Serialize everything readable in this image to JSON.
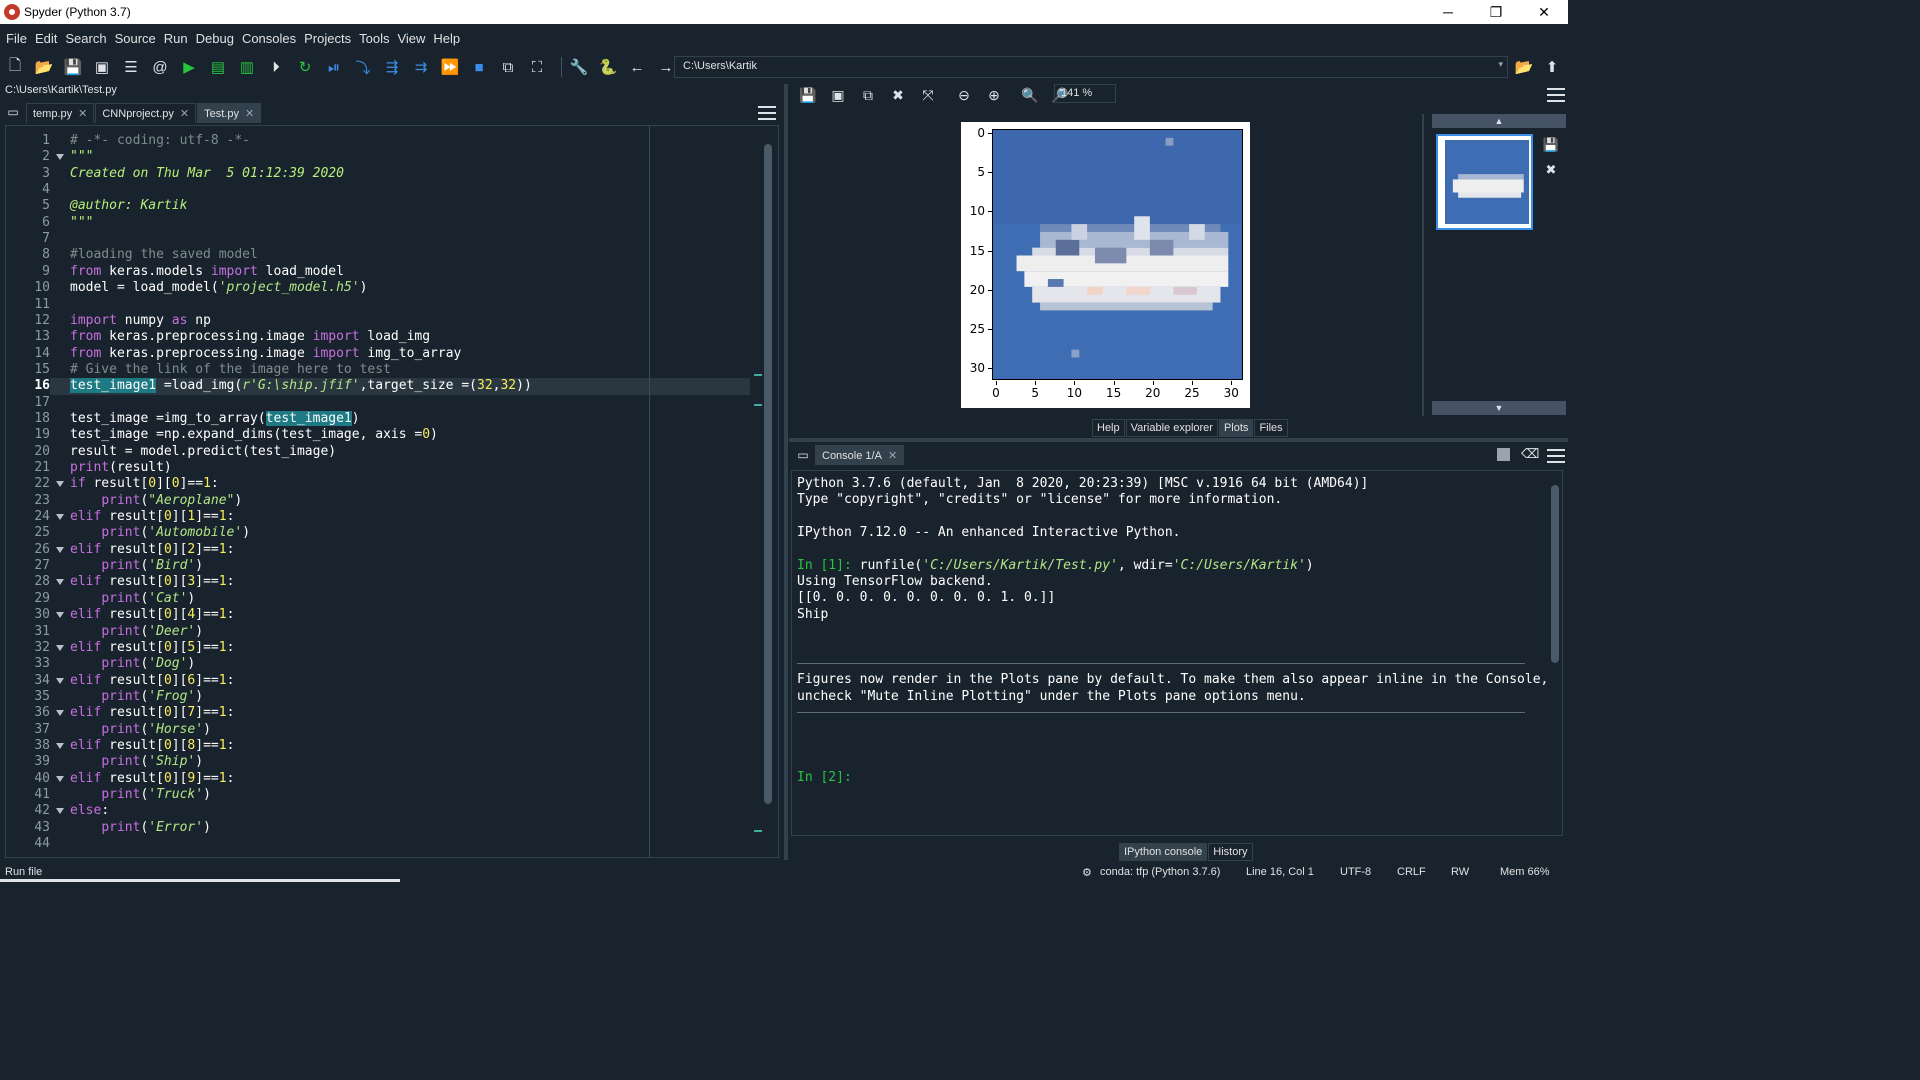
{
  "window": {
    "title": "Spyder (Python 3.7)",
    "minimize": "─",
    "restore": "❐",
    "close": "✕"
  },
  "menu": [
    "File",
    "Edit",
    "Search",
    "Source",
    "Run",
    "Debug",
    "Consoles",
    "Projects",
    "Tools",
    "View",
    "Help"
  ],
  "toolbar": {
    "working_dir": "C:\\Users\\Kartik"
  },
  "editor": {
    "file_path": "C:\\Users\\Kartik\\Test.py",
    "tabs": [
      {
        "label": "temp.py",
        "active": false
      },
      {
        "label": "CNNproject.py",
        "active": false
      },
      {
        "label": "Test.py",
        "active": true
      }
    ],
    "current_line": 16,
    "lines": [
      {
        "n": 1,
        "tokens": [
          [
            "c-comment",
            "# -*- coding: utf-8 -*-"
          ]
        ]
      },
      {
        "n": 2,
        "fold": true,
        "tokens": [
          [
            "c-doc",
            "\"\"\""
          ]
        ]
      },
      {
        "n": 3,
        "tokens": [
          [
            "c-doc",
            "Created on Thu Mar  5 01:12:39 2020"
          ]
        ]
      },
      {
        "n": 4,
        "tokens": []
      },
      {
        "n": 5,
        "tokens": [
          [
            "c-doc",
            "@author: Kartik"
          ]
        ]
      },
      {
        "n": 6,
        "tokens": [
          [
            "c-doc",
            "\"\"\""
          ]
        ]
      },
      {
        "n": 7,
        "tokens": []
      },
      {
        "n": 8,
        "tokens": [
          [
            "c-comment",
            "#loading the saved model"
          ]
        ]
      },
      {
        "n": 9,
        "tokens": [
          [
            "c-kw",
            "from"
          ],
          [
            "c-name",
            " keras.models "
          ],
          [
            "c-kw",
            "import"
          ],
          [
            "c-name",
            " load_model"
          ]
        ]
      },
      {
        "n": 10,
        "tokens": [
          [
            "c-name",
            "model = load_model("
          ],
          [
            "c-str",
            "'project_model.h5'"
          ],
          [
            "c-name",
            ")"
          ]
        ]
      },
      {
        "n": 11,
        "tokens": []
      },
      {
        "n": 12,
        "tokens": [
          [
            "c-kw",
            "import"
          ],
          [
            "c-name",
            " numpy "
          ],
          [
            "c-kw",
            "as"
          ],
          [
            "c-name",
            " np"
          ]
        ]
      },
      {
        "n": 13,
        "tokens": [
          [
            "c-kw",
            "from"
          ],
          [
            "c-name",
            " keras.preprocessing.image "
          ],
          [
            "c-kw",
            "import"
          ],
          [
            "c-name",
            " load_img"
          ]
        ]
      },
      {
        "n": 14,
        "tokens": [
          [
            "c-kw",
            "from"
          ],
          [
            "c-name",
            " keras.preprocessing.image "
          ],
          [
            "c-kw",
            "import"
          ],
          [
            "c-name",
            " img_to_array"
          ]
        ]
      },
      {
        "n": 15,
        "tokens": [
          [
            "c-comment",
            "# Give the link of the image here to test"
          ]
        ]
      },
      {
        "n": 16,
        "tokens": [
          [
            "c-name hl",
            "test_image1"
          ],
          [
            "c-name",
            " =load_img("
          ],
          [
            "c-str",
            "r'G:\\ship.jfif'"
          ],
          [
            "c-name",
            ",target_size =("
          ],
          [
            "c-num",
            "32"
          ],
          [
            "c-name",
            ","
          ],
          [
            "c-num",
            "32"
          ],
          [
            "c-name",
            "))"
          ]
        ]
      },
      {
        "n": 17,
        "tokens": []
      },
      {
        "n": 18,
        "tokens": [
          [
            "c-name",
            "test_image =img_to_array("
          ],
          [
            "c-name hl",
            "test_image1"
          ],
          [
            "c-name",
            ")"
          ]
        ]
      },
      {
        "n": 19,
        "tokens": [
          [
            "c-name",
            "test_image =np.expand_dims(test_image, axis ="
          ],
          [
            "c-num",
            "0"
          ],
          [
            "c-name",
            ")"
          ]
        ]
      },
      {
        "n": 20,
        "tokens": [
          [
            "c-name",
            "result = model.predict(test_image)"
          ]
        ]
      },
      {
        "n": 21,
        "tokens": [
          [
            "c-kw",
            "print"
          ],
          [
            "c-name",
            "(result)"
          ]
        ]
      },
      {
        "n": 22,
        "fold": true,
        "tokens": [
          [
            "c-kw",
            "if"
          ],
          [
            "c-name",
            " result["
          ],
          [
            "c-num",
            "0"
          ],
          [
            "c-name",
            "]["
          ],
          [
            "c-num",
            "0"
          ],
          [
            "c-name",
            "]=="
          ],
          [
            "c-num",
            "1"
          ],
          [
            "c-name",
            ":"
          ]
        ]
      },
      {
        "n": 23,
        "tokens": [
          [
            "c-name",
            "    "
          ],
          [
            "c-kw",
            "print"
          ],
          [
            "c-name",
            "("
          ],
          [
            "c-str",
            "\"Aeroplane\""
          ],
          [
            "c-name",
            ")"
          ]
        ]
      },
      {
        "n": 24,
        "fold": true,
        "tokens": [
          [
            "c-kw",
            "elif"
          ],
          [
            "c-name",
            " result["
          ],
          [
            "c-num",
            "0"
          ],
          [
            "c-name",
            "]["
          ],
          [
            "c-num",
            "1"
          ],
          [
            "c-name",
            "]=="
          ],
          [
            "c-num",
            "1"
          ],
          [
            "c-name",
            ":"
          ]
        ]
      },
      {
        "n": 25,
        "tokens": [
          [
            "c-name",
            "    "
          ],
          [
            "c-kw",
            "print"
          ],
          [
            "c-name",
            "("
          ],
          [
            "c-str",
            "'Automobile'"
          ],
          [
            "c-name",
            ")"
          ]
        ]
      },
      {
        "n": 26,
        "fold": true,
        "tokens": [
          [
            "c-kw",
            "elif"
          ],
          [
            "c-name",
            " result["
          ],
          [
            "c-num",
            "0"
          ],
          [
            "c-name",
            "]["
          ],
          [
            "c-num",
            "2"
          ],
          [
            "c-name",
            "]=="
          ],
          [
            "c-num",
            "1"
          ],
          [
            "c-name",
            ":"
          ]
        ]
      },
      {
        "n": 27,
        "tokens": [
          [
            "c-name",
            "    "
          ],
          [
            "c-kw",
            "print"
          ],
          [
            "c-name",
            "("
          ],
          [
            "c-str",
            "'Bird'"
          ],
          [
            "c-name",
            ")"
          ]
        ]
      },
      {
        "n": 28,
        "fold": true,
        "tokens": [
          [
            "c-kw",
            "elif"
          ],
          [
            "c-name",
            " result["
          ],
          [
            "c-num",
            "0"
          ],
          [
            "c-name",
            "]["
          ],
          [
            "c-num",
            "3"
          ],
          [
            "c-name",
            "]=="
          ],
          [
            "c-num",
            "1"
          ],
          [
            "c-name",
            ":"
          ]
        ]
      },
      {
        "n": 29,
        "tokens": [
          [
            "c-name",
            "    "
          ],
          [
            "c-kw",
            "print"
          ],
          [
            "c-name",
            "("
          ],
          [
            "c-str",
            "'Cat'"
          ],
          [
            "c-name",
            ")"
          ]
        ]
      },
      {
        "n": 30,
        "fold": true,
        "tokens": [
          [
            "c-kw",
            "elif"
          ],
          [
            "c-name",
            " result["
          ],
          [
            "c-num",
            "0"
          ],
          [
            "c-name",
            "]["
          ],
          [
            "c-num",
            "4"
          ],
          [
            "c-name",
            "]=="
          ],
          [
            "c-num",
            "1"
          ],
          [
            "c-name",
            ":"
          ]
        ]
      },
      {
        "n": 31,
        "tokens": [
          [
            "c-name",
            "    "
          ],
          [
            "c-kw",
            "print"
          ],
          [
            "c-name",
            "("
          ],
          [
            "c-str",
            "'Deer'"
          ],
          [
            "c-name",
            ")"
          ]
        ]
      },
      {
        "n": 32,
        "fold": true,
        "tokens": [
          [
            "c-kw",
            "elif"
          ],
          [
            "c-name",
            " result["
          ],
          [
            "c-num",
            "0"
          ],
          [
            "c-name",
            "]["
          ],
          [
            "c-num",
            "5"
          ],
          [
            "c-name",
            "]=="
          ],
          [
            "c-num",
            "1"
          ],
          [
            "c-name",
            ":"
          ]
        ]
      },
      {
        "n": 33,
        "tokens": [
          [
            "c-name",
            "    "
          ],
          [
            "c-kw",
            "print"
          ],
          [
            "c-name",
            "("
          ],
          [
            "c-str",
            "'Dog'"
          ],
          [
            "c-name",
            ")"
          ]
        ]
      },
      {
        "n": 34,
        "fold": true,
        "tokens": [
          [
            "c-kw",
            "elif"
          ],
          [
            "c-name",
            " result["
          ],
          [
            "c-num",
            "0"
          ],
          [
            "c-name",
            "]["
          ],
          [
            "c-num",
            "6"
          ],
          [
            "c-name",
            "]=="
          ],
          [
            "c-num",
            "1"
          ],
          [
            "c-name",
            ":"
          ]
        ]
      },
      {
        "n": 35,
        "tokens": [
          [
            "c-name",
            "    "
          ],
          [
            "c-kw",
            "print"
          ],
          [
            "c-name",
            "("
          ],
          [
            "c-str",
            "'Frog'"
          ],
          [
            "c-name",
            ")"
          ]
        ]
      },
      {
        "n": 36,
        "fold": true,
        "tokens": [
          [
            "c-kw",
            "elif"
          ],
          [
            "c-name",
            " result["
          ],
          [
            "c-num",
            "0"
          ],
          [
            "c-name",
            "]["
          ],
          [
            "c-num",
            "7"
          ],
          [
            "c-name",
            "]=="
          ],
          [
            "c-num",
            "1"
          ],
          [
            "c-name",
            ":"
          ]
        ]
      },
      {
        "n": 37,
        "tokens": [
          [
            "c-name",
            "    "
          ],
          [
            "c-kw",
            "print"
          ],
          [
            "c-name",
            "("
          ],
          [
            "c-str",
            "'Horse'"
          ],
          [
            "c-name",
            ")"
          ]
        ]
      },
      {
        "n": 38,
        "fold": true,
        "tokens": [
          [
            "c-kw",
            "elif"
          ],
          [
            "c-name",
            " result["
          ],
          [
            "c-num",
            "0"
          ],
          [
            "c-name",
            "]["
          ],
          [
            "c-num",
            "8"
          ],
          [
            "c-name",
            "]=="
          ],
          [
            "c-num",
            "1"
          ],
          [
            "c-name",
            ":"
          ]
        ]
      },
      {
        "n": 39,
        "tokens": [
          [
            "c-name",
            "    "
          ],
          [
            "c-kw",
            "print"
          ],
          [
            "c-name",
            "("
          ],
          [
            "c-str",
            "'Ship'"
          ],
          [
            "c-name",
            ")"
          ]
        ]
      },
      {
        "n": 40,
        "fold": true,
        "tokens": [
          [
            "c-kw",
            "elif"
          ],
          [
            "c-name",
            " result["
          ],
          [
            "c-num",
            "0"
          ],
          [
            "c-name",
            "]["
          ],
          [
            "c-num",
            "9"
          ],
          [
            "c-name",
            "]=="
          ],
          [
            "c-num",
            "1"
          ],
          [
            "c-name",
            ":"
          ]
        ]
      },
      {
        "n": 41,
        "tokens": [
          [
            "c-name",
            "    "
          ],
          [
            "c-kw",
            "print"
          ],
          [
            "c-name",
            "("
          ],
          [
            "c-str",
            "'Truck'"
          ],
          [
            "c-name",
            ")"
          ]
        ]
      },
      {
        "n": 42,
        "fold": true,
        "tokens": [
          [
            "c-kw",
            "else"
          ],
          [
            "c-name",
            ":"
          ]
        ]
      },
      {
        "n": 43,
        "tokens": [
          [
            "c-name",
            "    "
          ],
          [
            "c-kw",
            "print"
          ],
          [
            "c-name",
            "("
          ],
          [
            "c-str",
            "'Error'"
          ],
          [
            "c-name",
            ")"
          ]
        ]
      },
      {
        "n": 44,
        "tokens": []
      }
    ]
  },
  "plots": {
    "zoom": "141 %",
    "y_ticks": [
      "0",
      "5",
      "10",
      "15",
      "20",
      "25",
      "30"
    ],
    "x_ticks": [
      "0",
      "5",
      "10",
      "15",
      "20",
      "25",
      "30"
    ],
    "pane_tabs": [
      {
        "label": "Help",
        "active": false
      },
      {
        "label": "Variable explorer",
        "active": false
      },
      {
        "label": "Plots",
        "active": true
      },
      {
        "label": "Files",
        "active": false
      }
    ]
  },
  "console": {
    "tab_label": "Console 1/A",
    "lines": [
      [
        [
          "",
          "Python 3.7.6 (default, Jan  8 2020, 20:23:39) [MSC v.1916 64 bit (AMD64)]"
        ]
      ],
      [
        [
          "",
          "Type \"copyright\", \"credits\" or \"license\" for more information."
        ]
      ],
      [],
      [
        [
          "",
          "IPython 7.12.0 -- An enhanced Interactive Python."
        ]
      ],
      [],
      [
        [
          "cprompt",
          "In [1]: "
        ],
        [
          "",
          "runfile("
        ],
        [
          "cstr",
          "'C:/Users/Kartik/Test.py'"
        ],
        [
          "",
          ", wdir="
        ],
        [
          "cstr",
          "'C:/Users/Kartik'"
        ],
        [
          "",
          ")"
        ]
      ],
      [
        [
          "",
          "Using TensorFlow backend."
        ]
      ],
      [
        [
          "",
          "[[0. 0. 0. 0. 0. 0. 0. 0. 1. 0.]]"
        ]
      ],
      [
        [
          "",
          "Ship"
        ]
      ]
    ],
    "notice": [
      "Figures now render in the Plots pane by default. To make them also appear inline in the Console,",
      "uncheck \"Mute Inline Plotting\" under the Plots pane options menu."
    ],
    "prompt": "In [2]:",
    "pane_tabs": [
      {
        "label": "IPython console",
        "active": true
      },
      {
        "label": "History",
        "active": false
      }
    ]
  },
  "status": {
    "left": "Run file",
    "conda": "conda: tfp (Python 3.7.6)",
    "position": "Line 16, Col 1",
    "encoding": "UTF-8",
    "eol": "CRLF",
    "mode": "RW",
    "memory": "Mem 66%"
  }
}
